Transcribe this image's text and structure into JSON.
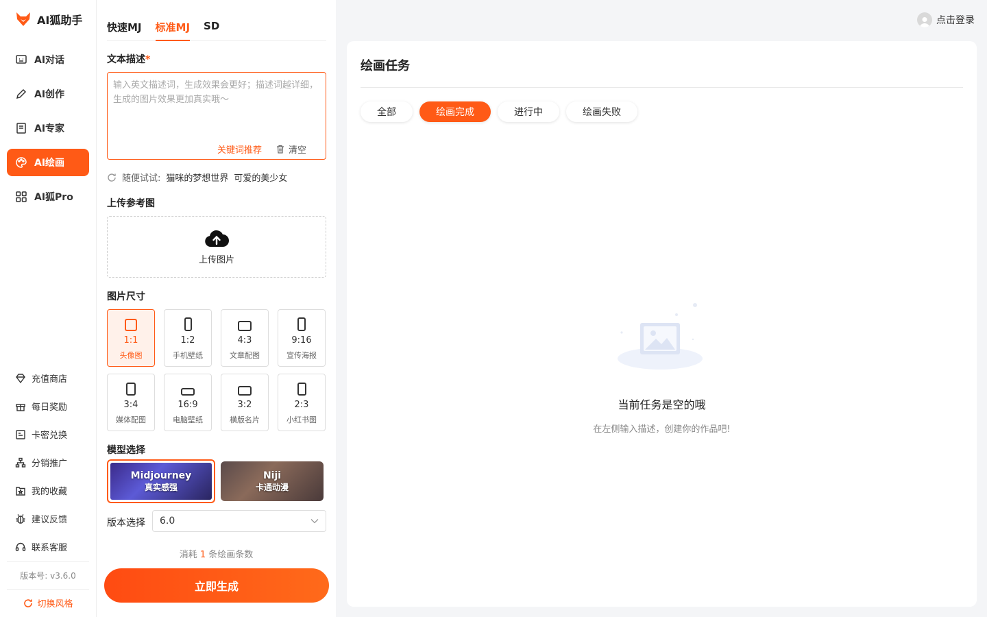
{
  "app": {
    "title": "AI狐助手",
    "brand_color": "#ff5a16"
  },
  "nav": {
    "items": [
      {
        "label": "AI对话",
        "icon": "chat-icon"
      },
      {
        "label": "AI创作",
        "icon": "pen-icon"
      },
      {
        "label": "AI专家",
        "icon": "book-icon"
      },
      {
        "label": "AI绘画",
        "icon": "palette-icon",
        "active": true
      },
      {
        "label": "AI狐Pro",
        "icon": "grid-icon"
      }
    ],
    "bottom": [
      {
        "label": "充值商店",
        "icon": "diamond-icon"
      },
      {
        "label": "每日奖励",
        "icon": "gift-icon"
      },
      {
        "label": "卡密兑换",
        "icon": "card-icon"
      },
      {
        "label": "分销推广",
        "icon": "network-icon"
      },
      {
        "label": "我的收藏",
        "icon": "star-folder-icon"
      },
      {
        "label": "建议反馈",
        "icon": "bug-icon"
      },
      {
        "label": "联系客服",
        "icon": "headset-icon"
      }
    ],
    "version": "版本号: v3.6.0",
    "switch_style": "切换风格"
  },
  "panel": {
    "tabs": [
      "快速MJ",
      "标准MJ",
      "SD"
    ],
    "active_tab": "标准MJ",
    "prompt_label": "文本描述",
    "required_mark": "*",
    "prompt_placeholder": "输入英文描述词，生成效果会更好；描述词越详细，生成的图片效果更加真实哦～",
    "keyword_btn": "关键词推荐",
    "clear_btn": "清空",
    "try_label": "随便试试:",
    "suggestions": [
      "猫咪的梦想世界",
      "可爱的美少女"
    ],
    "upload_label": "上传参考图",
    "upload_btn": "上传图片",
    "size_label": "图片尺寸",
    "sizes": [
      {
        "ratio": "1:1",
        "desc": "头像图",
        "active": true
      },
      {
        "ratio": "1:2",
        "desc": "手机壁纸"
      },
      {
        "ratio": "4:3",
        "desc": "文章配图"
      },
      {
        "ratio": "9:16",
        "desc": "宣传海报"
      },
      {
        "ratio": "3:4",
        "desc": "媒体配图"
      },
      {
        "ratio": "16:9",
        "desc": "电脑壁纸"
      },
      {
        "ratio": "3:2",
        "desc": "横版名片"
      },
      {
        "ratio": "2:3",
        "desc": "小红书图"
      }
    ],
    "model_label": "模型选择",
    "models": [
      {
        "name": "Midjourney",
        "sub": "真实感强",
        "active": true
      },
      {
        "name": "Niji",
        "sub": "卡通动漫"
      }
    ],
    "version_label": "版本选择",
    "version_value": "6.0",
    "cost_prefix": "消耗",
    "cost_num": "1",
    "cost_suffix": "条绘画条数",
    "generate_btn": "立即生成"
  },
  "header": {
    "login": "点击登录"
  },
  "tasks": {
    "title": "绘画任务",
    "filters": [
      "全部",
      "绘画完成",
      "进行中",
      "绘画失败"
    ],
    "active_filter": "绘画完成",
    "empty_title": "当前任务是空的哦",
    "empty_sub": "在左侧输入描述，创建你的作品吧!"
  }
}
